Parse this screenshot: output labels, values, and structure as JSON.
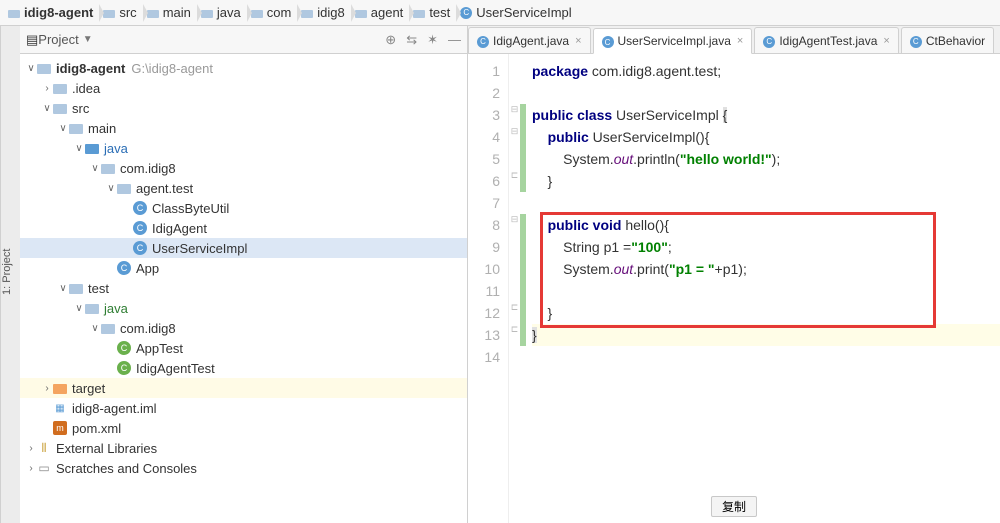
{
  "breadcrumbs": [
    {
      "label": "idig8-agent",
      "type": "root"
    },
    {
      "label": "src",
      "type": "folder"
    },
    {
      "label": "main",
      "type": "folder"
    },
    {
      "label": "java",
      "type": "folder"
    },
    {
      "label": "com",
      "type": "folder"
    },
    {
      "label": "idig8",
      "type": "folder"
    },
    {
      "label": "agent",
      "type": "folder"
    },
    {
      "label": "test",
      "type": "folder"
    },
    {
      "label": "UserServiceImpl",
      "type": "class"
    }
  ],
  "projectPanel": {
    "title": "Project"
  },
  "leftGutter": {
    "label": "1: Project"
  },
  "tree": {
    "root": {
      "label": "idig8-agent",
      "path": "G:\\idig8-agent"
    },
    "idea": ".idea",
    "src": "src",
    "main": "main",
    "java": "java",
    "comidig8": "com.idig8",
    "agenttest": "agent.test",
    "classbyteutil": "ClassByteUtil",
    "idigagent": "IdigAgent",
    "userserviceimpl": "UserServiceImpl",
    "app": "App",
    "test": "test",
    "java2": "java",
    "comidig82": "com.idig8",
    "apptest": "AppTest",
    "idigagenttest": "IdigAgentTest",
    "target": "target",
    "iml": "idig8-agent.iml",
    "pom": "pom.xml",
    "extlib": "External Libraries",
    "scratch": "Scratches and Consoles"
  },
  "tabs": [
    {
      "label": "IdigAgent.java",
      "active": false
    },
    {
      "label": "UserServiceImpl.java",
      "active": true
    },
    {
      "label": "IdigAgentTest.java",
      "active": false
    },
    {
      "label": "CtBehavior",
      "active": false,
      "noclose": true
    }
  ],
  "editor": {
    "lines": [
      {
        "n": 1,
        "html": "<span class='kw'>package</span> com.idig8.agent.test;"
      },
      {
        "n": 2,
        "html": ""
      },
      {
        "n": 3,
        "html": "<span class='kw'>public class</span> UserServiceImpl <span class='brace-hl'>{</span>"
      },
      {
        "n": 4,
        "html": "    <span class='kw'>public</span> UserServiceImpl(){"
      },
      {
        "n": 5,
        "html": "        System.<span class='field'>out</span>.println(<span class='str'>\"hello world!\"</span>);"
      },
      {
        "n": 6,
        "html": "    }"
      },
      {
        "n": 7,
        "html": ""
      },
      {
        "n": 8,
        "html": "    <span class='kw'>public void</span> hello(){"
      },
      {
        "n": 9,
        "html": "        String p1 =<span class='str'>\"100\"</span>;"
      },
      {
        "n": 10,
        "html": "        System.<span class='field'>out</span>.print(<span class='str'>\"p1 = \"</span>+p1);"
      },
      {
        "n": 11,
        "html": ""
      },
      {
        "n": 12,
        "html": "    }"
      },
      {
        "n": 13,
        "html": "<span class='brace-hl'>}</span>",
        "cls": "line-hl"
      },
      {
        "n": 14,
        "html": ""
      }
    ]
  },
  "copyBtn": "复制"
}
